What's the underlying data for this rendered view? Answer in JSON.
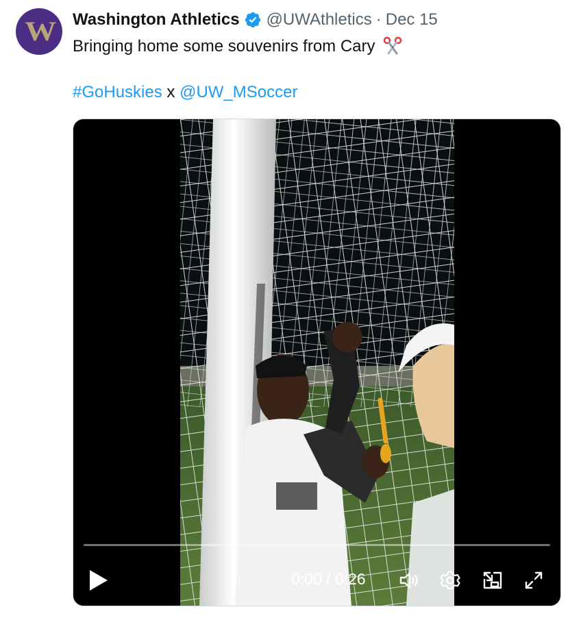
{
  "tweet": {
    "avatar_letter": "W",
    "display_name": "Washington Athletics",
    "handle": "@UWAthletics",
    "separator": "·",
    "date": "Dec 15",
    "text": "Bringing home some souvenirs from Cary",
    "emoji": "scissors-emoji",
    "hashtag": "#GoHuskies",
    "connector": "x",
    "mention": "@UW_MSoccer"
  },
  "video": {
    "time_display": "0:00 / 0:26",
    "progress": 0.0
  },
  "icons": {
    "verified": "verified-badge-icon",
    "play": "play-icon",
    "volume": "volume-icon",
    "settings": "settings-gear-icon",
    "pip": "picture-in-picture-icon",
    "fullscreen": "fullscreen-icon"
  },
  "colors": {
    "brand_purple": "#4b2e83",
    "brand_gold": "#b7a57a",
    "link_blue": "#1d9bf0",
    "verified_blue": "#1d9bf0",
    "secondary_text": "#536471"
  }
}
